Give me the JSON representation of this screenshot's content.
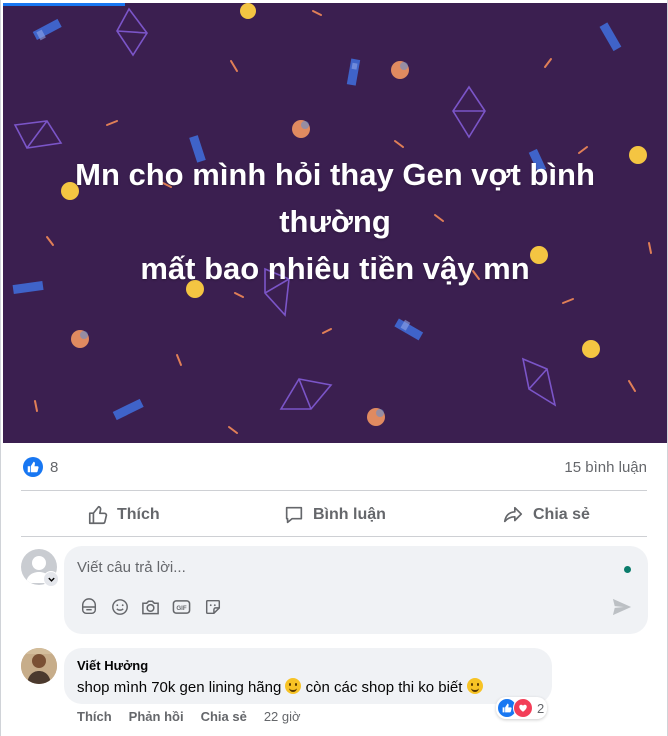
{
  "post": {
    "text_line1": "Mn cho mình hỏi thay Gen vợt bình",
    "text_line2": "thường",
    "text_line3": "mất bao nhiêu tiền vậy mn",
    "background_color": "#3b1f50"
  },
  "stats": {
    "like_count": "8",
    "comment_count": "15 bình luận"
  },
  "actions": {
    "like_label": "Thích",
    "comment_label": "Bình luận",
    "share_label": "Chia sẻ"
  },
  "composer": {
    "placeholder": "Viết câu trả lời...",
    "icons": [
      "sticker-icon",
      "emoji-icon",
      "camera-icon",
      "gif-icon",
      "avatar-sticker-icon"
    ]
  },
  "comment": {
    "author": "Viết Hưởng",
    "text_part1": "shop mình 70k gen lining hãng ",
    "text_part2": " còn các shop thi ko biết ",
    "reaction_count": "2",
    "like_label": "Thích",
    "reply_label": "Phản hồi",
    "share_label": "Chia sẻ",
    "time": "22 giờ"
  },
  "colors": {
    "accent": "#1877f2",
    "love": "#f33e58",
    "muted_text": "#65676b",
    "bubble": "#f0f2f5"
  }
}
